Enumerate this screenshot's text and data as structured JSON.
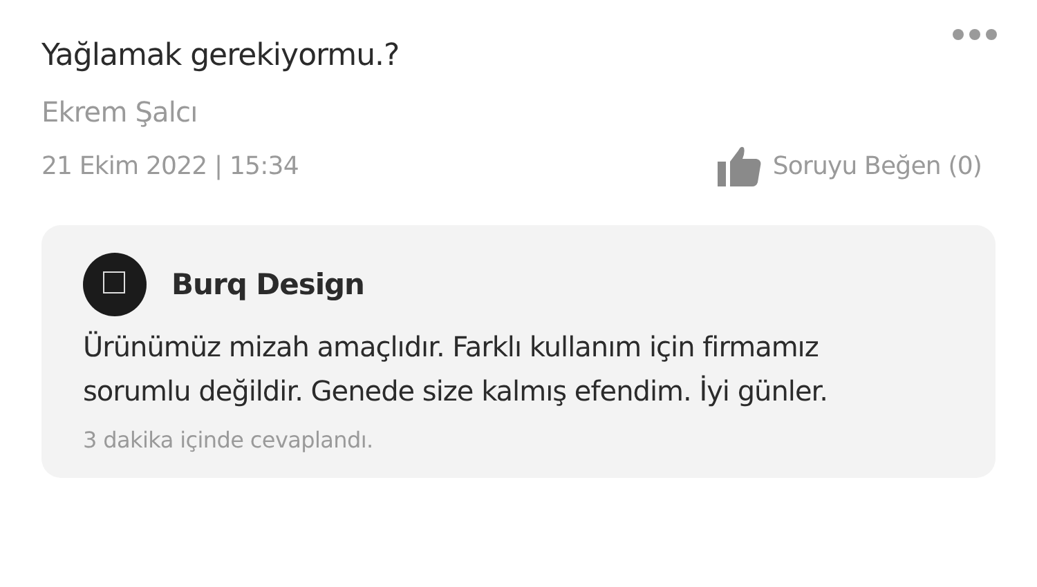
{
  "question": {
    "title": "Yağlamak gerekiyormu.?",
    "author": "Ekrem Şalcı",
    "date": "21 Ekim 2022 | 15:34",
    "like_label": "Soruyu Beğen (0)"
  },
  "answer": {
    "author": "Burq Design",
    "text": "Ürünümüz mizah amaçlıdır. Farklı kullanım için firmamız sorumlu değildir. Genede size kalmış efendim. İyi günler.",
    "footer": "3 dakika içinde cevaplandı."
  }
}
